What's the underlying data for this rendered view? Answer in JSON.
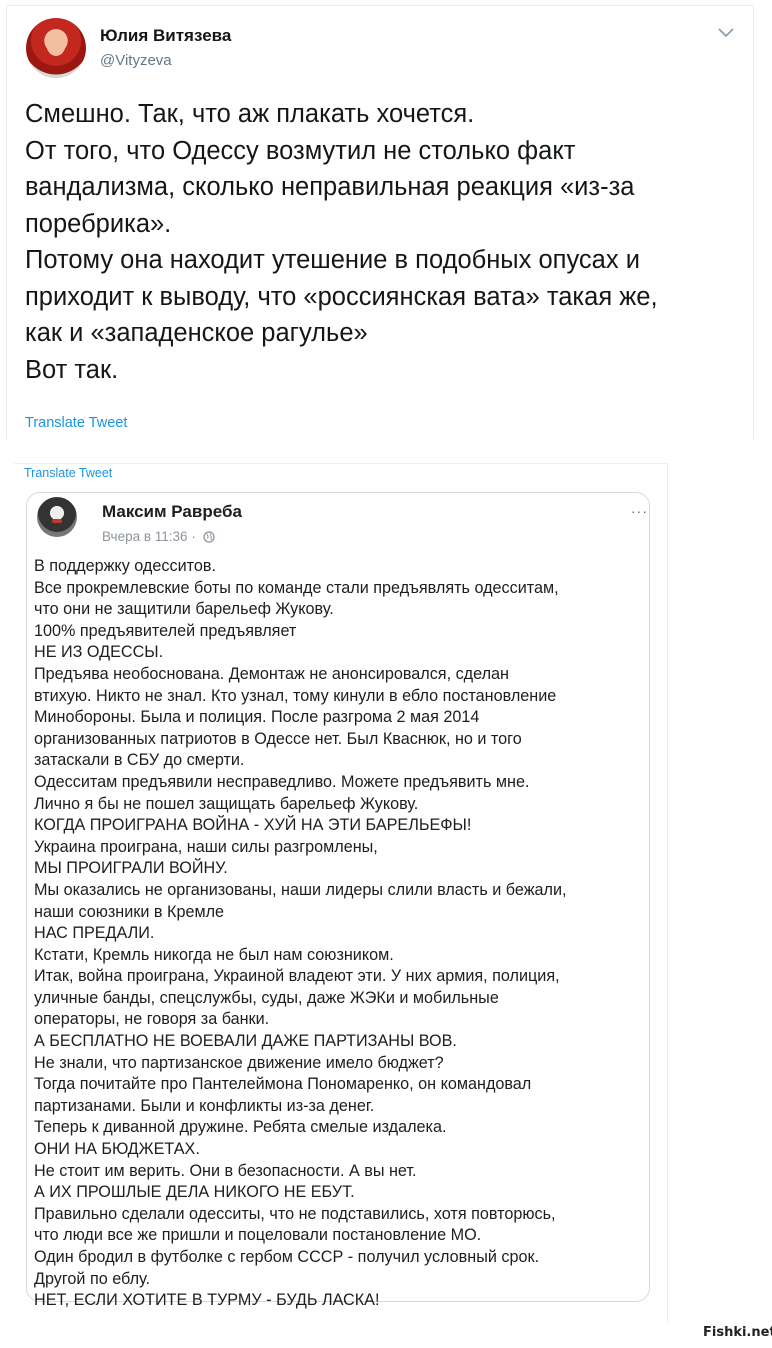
{
  "tweet": {
    "display_name": "Юлия Витязева",
    "handle": "@Vityzeva",
    "lines": [
      "Смешно. Так, что аж плакать хочется.",
      "От того, что Одессу возмутил не столько факт",
      "вандализма, сколько неправильная реакция «из-за",
      "поребрика».",
      "Потому она находит утешение в подобных опусах и",
      "приходит к выводу, что «россиянская вата» такая же,",
      "как и «западенское рагулье»",
      "Вот так."
    ],
    "translate_label": "Translate Tweet",
    "menu_icon": "chevron-down-icon"
  },
  "embedded": {
    "translate_label": "Translate Tweet",
    "fb_post": {
      "author": "Максим Равреба",
      "time": "Вчера в 11:36 ·",
      "privacy_icon": "globe-icon",
      "more_label": "···",
      "lines": [
        "В поддержку одесситов.",
        "Все прокремлевские боты по команде стали предъявлять одесситам,",
        "что они не защитили барельеф Жукову.",
        "100% предъявителей предъявляет",
        "НЕ ИЗ ОДЕССЫ.",
        "Предъява необоснована. Демонтаж не анонсировался, сделан",
        "втихую. Никто не знал. Кто узнал, тому кинули в ебло постановление",
        "Минобороны. Была и полиция. После разгрома 2 мая 2014",
        "организованных патриотов в Одессе нет. Был Кваснюк, но и того",
        "затаскали в СБУ до смерти.",
        "Одесситам предъявили несправедливо. Можете предъявить мне.",
        "Лично я бы не пошел защищать барельеф Жукову.",
        "КОГДА ПРОИГРАНА ВОЙНА - ХУЙ НА ЭТИ БАРЕЛЬЕФЫ!",
        "Украина проиграна, наши силы разгромлены,",
        "МЫ ПРОИГРАЛИ ВОЙНУ.",
        "Мы оказались не организованы, наши лидеры слили власть и бежали,",
        "наши союзники в Кремле",
        "НАС ПРЕДАЛИ.",
        "Кстати, Кремль никогда не был нам союзником.",
        "Итак, война проиграна, Украиной владеют эти. У них армия, полиция,",
        "уличные банды, спецслужбы, суды, даже ЖЭКи и мобильные",
        "операторы, не говоря за банки.",
        "А БЕСПЛАТНО НЕ ВОЕВАЛИ ДАЖЕ ПАРТИЗАНЫ ВОВ.",
        "Не знали, что партизанское движение имело бюджет?",
        "Тогда почитайте про Пантелеймона Пономаренко, он командовал",
        "партизанами. Были и конфликты из-за денег.",
        "Теперь к диванной дружине. Ребята смелые издалека.",
        "ОНИ НА БЮДЖЕТАХ.",
        "Не стоит им верить. Они в безопасности. А вы нет.",
        "А ИХ ПРОШЛЫЕ ДЕЛА НИКОГО НЕ ЕБУТ.",
        "Правильно сделали одесситы, что не подставились, хотя повторюсь,",
        "что люди все же пришли и поцеловали постановление МО.",
        "Один бродил в футболке с гербом СССР - получил условный срок.",
        "Другой по еблу.",
        "НЕТ, ЕСЛИ ХОТИТЕ В ТУРМУ - БУДЬ ЛАСКА!"
      ]
    }
  },
  "watermark": "Fishki.net",
  "colors": {
    "link": "#1b95e0",
    "muted": "#657786",
    "text": "#14171a"
  }
}
